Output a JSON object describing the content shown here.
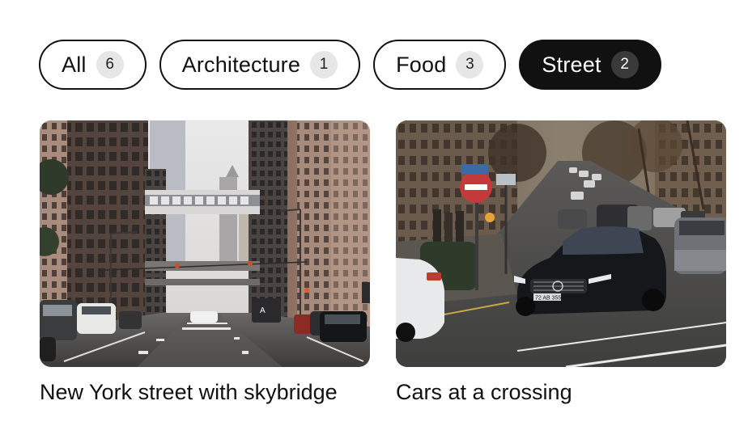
{
  "filters": [
    {
      "label": "All",
      "count": "6",
      "active": false
    },
    {
      "label": "Architecture",
      "count": "1",
      "active": false
    },
    {
      "label": "Food",
      "count": "3",
      "active": false
    },
    {
      "label": "Street",
      "count": "2",
      "active": true
    }
  ],
  "gallery": {
    "items": [
      {
        "caption": "New York street with skybridge"
      },
      {
        "caption": "Cars at a crossing",
        "plate_text": "72 AB 355"
      }
    ]
  }
}
